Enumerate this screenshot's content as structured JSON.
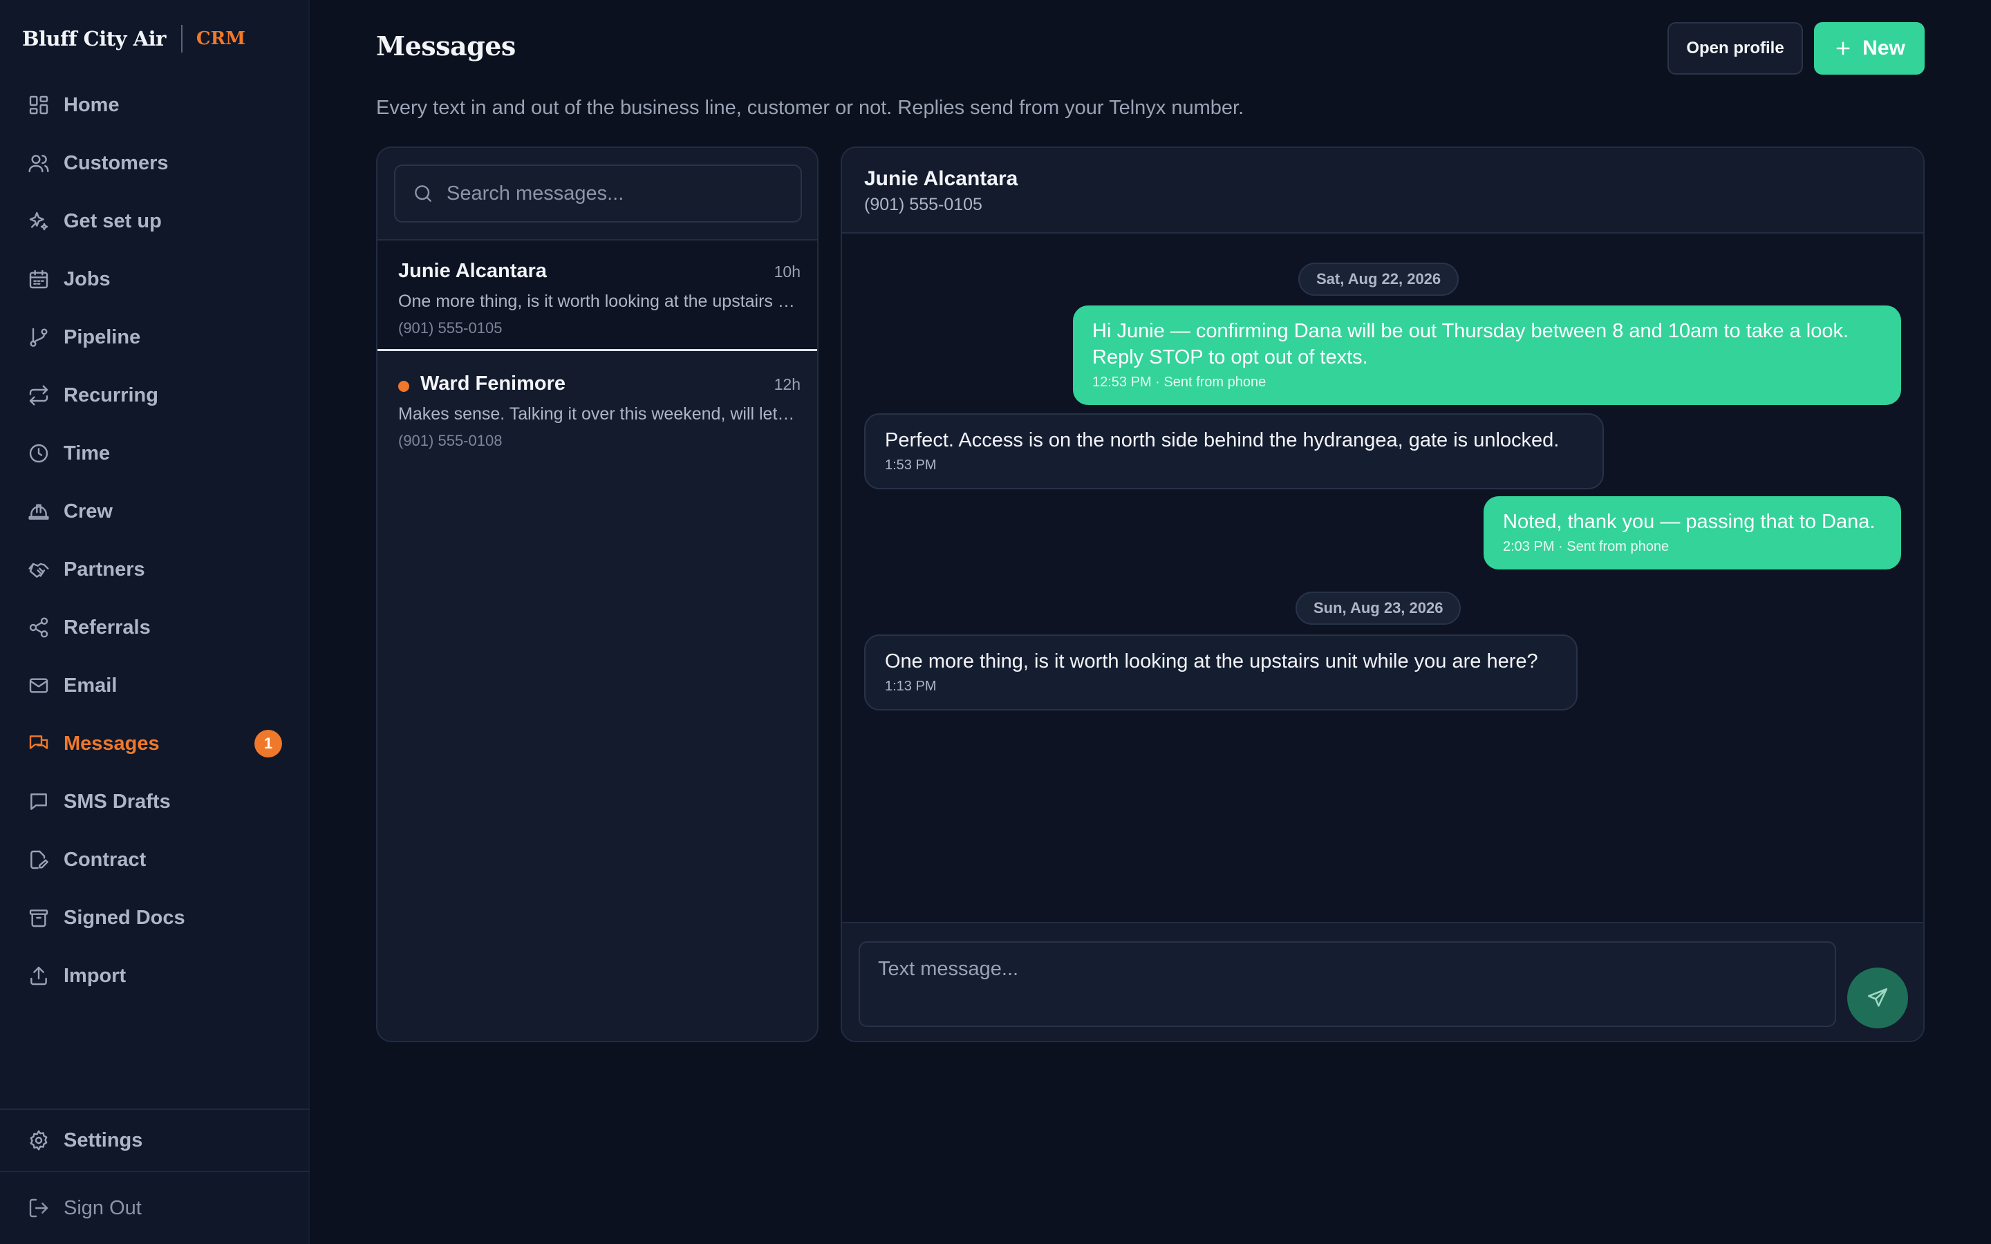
{
  "brand": {
    "name": "Bluff City Air",
    "tag": "CRM"
  },
  "nav": [
    {
      "label": "Home",
      "icon": "dashboard-icon"
    },
    {
      "label": "Customers",
      "icon": "users-icon"
    },
    {
      "label": "Get set up",
      "icon": "sparkles-icon"
    },
    {
      "label": "Jobs",
      "icon": "calendar-icon"
    },
    {
      "label": "Pipeline",
      "icon": "git-branch-icon"
    },
    {
      "label": "Recurring",
      "icon": "repeat-icon"
    },
    {
      "label": "Time",
      "icon": "clock-icon"
    },
    {
      "label": "Crew",
      "icon": "hard-hat-icon"
    },
    {
      "label": "Partners",
      "icon": "handshake-icon"
    },
    {
      "label": "Referrals",
      "icon": "share-icon"
    },
    {
      "label": "Email",
      "icon": "mail-icon"
    },
    {
      "label": "Messages",
      "icon": "chat-icon",
      "active": true,
      "badge": "1"
    },
    {
      "label": "SMS Drafts",
      "icon": "message-square-icon"
    },
    {
      "label": "Contract",
      "icon": "file-pen-icon"
    },
    {
      "label": "Signed Docs",
      "icon": "archive-icon"
    },
    {
      "label": "Import",
      "icon": "upload-icon"
    }
  ],
  "footer": {
    "settings": "Settings",
    "signout": "Sign Out"
  },
  "header": {
    "title": "Messages",
    "subtitle": "Every text in and out of the business line, customer or not. Replies send from your Telnyx number.",
    "open_profile": "Open profile",
    "new_label": "New"
  },
  "search": {
    "placeholder": "Search messages..."
  },
  "conversations": [
    {
      "name": "Junie Alcantara",
      "time": "10h",
      "preview": "One more thing, is it worth looking at the upstairs unit while you are here?",
      "phone": "(901) 555-0105",
      "selected": true,
      "unread": false
    },
    {
      "name": "Ward Fenimore",
      "time": "12h",
      "preview": "Makes sense. Talking it over this weekend, will let you know.",
      "phone": "(901) 555-0108",
      "selected": false,
      "unread": true
    }
  ],
  "thread": {
    "name": "Junie Alcantara",
    "phone": "(901) 555-0105",
    "date_1": "Sat, Aug 22, 2026",
    "date_2": "Sun, Aug 23, 2026",
    "messages": [
      {
        "direction": "out",
        "text": "Hi Junie — confirming Dana will be out Thursday between 8 and 10am to take a look. Reply STOP to opt out of texts.",
        "meta": "12:53 PM · Sent from phone"
      },
      {
        "direction": "in",
        "text": "Perfect. Access is on the north side behind the hydrangea, gate is unlocked.",
        "meta": "1:53 PM"
      },
      {
        "direction": "out",
        "text": "Noted, thank you — passing that to Dana.",
        "meta": "2:03 PM · Sent from phone"
      },
      {
        "direction": "in",
        "text": "One more thing, is it worth looking at the upstairs unit while you are here?",
        "meta": "1:13 PM"
      }
    ]
  },
  "composer": {
    "placeholder": "Text message..."
  },
  "colors": {
    "accent": "#f0782a",
    "primary": "#34d399",
    "background": "#0b111e",
    "sidebar": "#0f1729"
  }
}
